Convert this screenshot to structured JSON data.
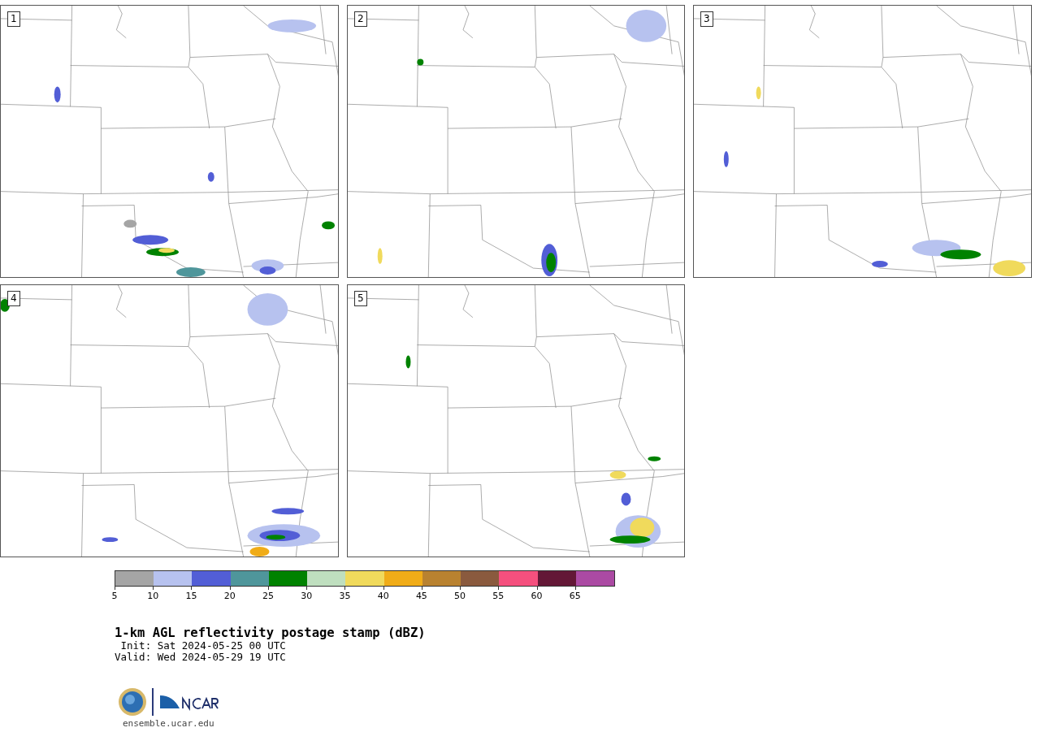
{
  "panels": [
    {
      "label": "1"
    },
    {
      "label": "2"
    },
    {
      "label": "3"
    },
    {
      "label": "4"
    },
    {
      "label": "5"
    }
  ],
  "colorbar": {
    "bins": [
      {
        "color": "#a5a5a5",
        "tick": "5"
      },
      {
        "color": "#b7c2ef",
        "tick": "10"
      },
      {
        "color": "#525ed6",
        "tick": "15"
      },
      {
        "color": "#4f969b",
        "tick": "20"
      },
      {
        "color": "#008200",
        "tick": "25"
      },
      {
        "color": "#bfdfbf",
        "tick": "30"
      },
      {
        "color": "#f0da5c",
        "tick": "35"
      },
      {
        "color": "#f0ac18",
        "tick": "40"
      },
      {
        "color": "#b98230",
        "tick": "45"
      },
      {
        "color": "#8a5a3e",
        "tick": "50"
      },
      {
        "color": "#f5507e",
        "tick": "55"
      },
      {
        "color": "#631736",
        "tick": "60"
      },
      {
        "color": "#ab4aa3",
        "tick": "65"
      }
    ]
  },
  "title": "1-km AGL reflectivity postage stamp (dBZ)",
  "init": " Init: Sat 2024-05-25 00 UTC",
  "valid": "Valid: Wed 2024-05-29 19 UTC",
  "site": "ensemble.ucar.edu"
}
